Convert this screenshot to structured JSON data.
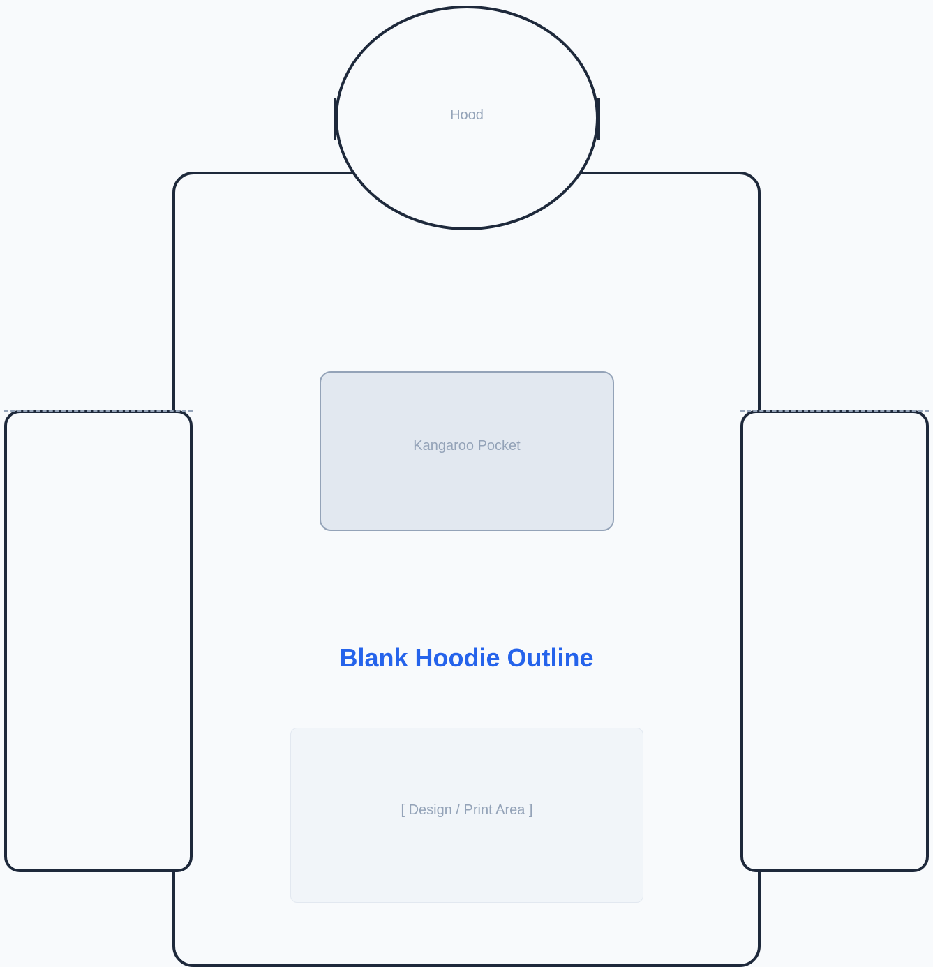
{
  "diagram": {
    "hood_label": "Hood",
    "pocket_label": "Kangaroo Pocket",
    "title": "Blank Hoodie Outline",
    "print_area_label": "[ Design / Print Area ]"
  },
  "colors": {
    "outline": "#1e293b",
    "title": "#2563eb",
    "muted_text": "#94a3b8",
    "pocket_fill": "#e2e8f0",
    "print_area_fill": "#f1f5f9",
    "background": "#f8fafc"
  }
}
